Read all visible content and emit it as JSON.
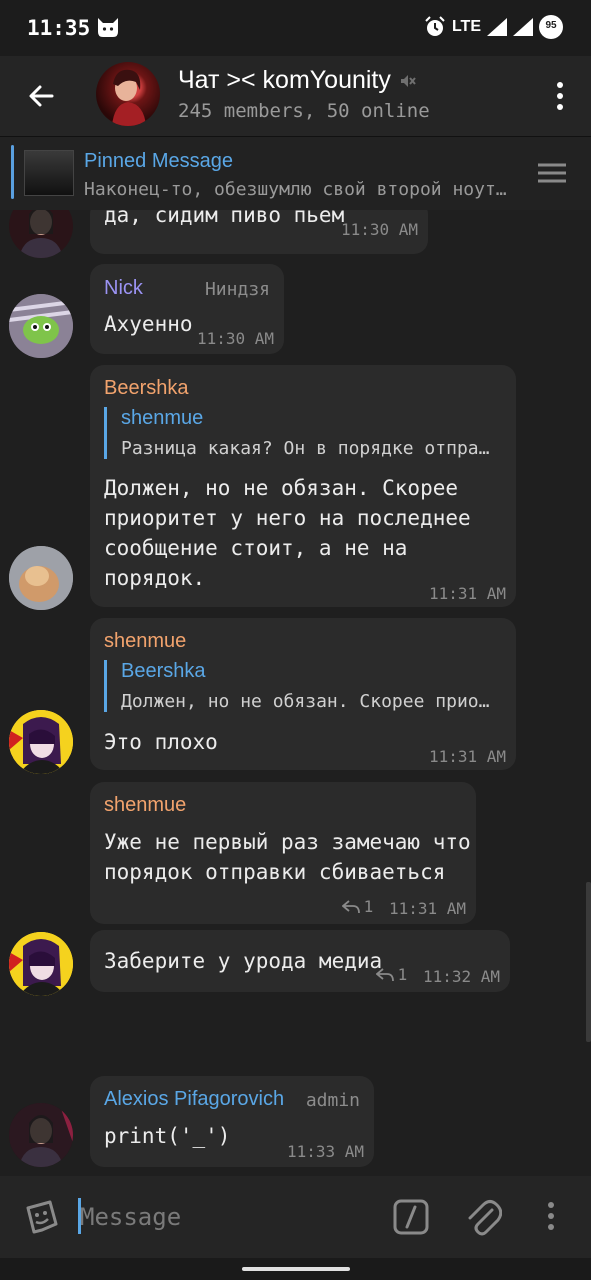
{
  "status_bar": {
    "time": "11:35",
    "network": "LTE",
    "battery": "95"
  },
  "header": {
    "title": "Чат >< komYounity",
    "subtitle": "245 members, 50 online",
    "icons": [
      "back-arrow-icon",
      "mute-icon",
      "more-vert-icon"
    ]
  },
  "pinned": {
    "title": "Pinned Message",
    "text": "Наконец-то, обезшумлю свой второй ноут…"
  },
  "colors": {
    "accent": "#5aa7e6",
    "name_nick": "#9b93f3",
    "name_orange": "#f2a36d",
    "bubble_bg": "#2b2b2b",
    "chat_bg": "#1f1f1f"
  },
  "messages": [
    {
      "text": "да, сидим пиво пьем",
      "time": "11:30 AM"
    },
    {
      "name": "Nick",
      "role": "Ниндзя",
      "text": "Ахуенно",
      "time": "11:30 AM"
    },
    {
      "name": "Beershka",
      "reply": {
        "name": "shenmue",
        "text": "Разница какая? Он в порядке отпра…"
      },
      "text": "Должен, но не обязан. Скорее\nприоритет у него на последнее\nсообщение стоит, а не на\nпорядок.",
      "time": "11:31 AM"
    },
    {
      "name": "shenmue",
      "reply": {
        "name": "Beershka",
        "text": "Должен, но не обязан. Скорее прио…"
      },
      "text": "Это плохо",
      "time": "11:31 AM"
    },
    {
      "name": "shenmue",
      "text": "Уже не первый раз замечаю что\nпорядок отправки сбиваеться",
      "reply_count": "1",
      "time": "11:31 AM"
    },
    {
      "text": "Заберите у урода медиа",
      "reply_count": "1",
      "time": "11:32 AM"
    },
    {
      "name": "Alexios Pifagorovich",
      "role": "admin",
      "text": "print('_')",
      "time": "11:33 AM"
    }
  ],
  "composer": {
    "placeholder": "Message"
  }
}
